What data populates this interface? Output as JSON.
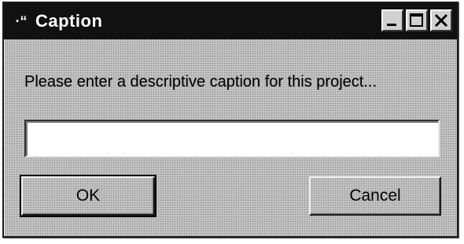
{
  "window": {
    "title": "Caption",
    "icon": "caption-app-icon",
    "title_icon_glyph": "·“",
    "controls": [
      "minimize-icon",
      "maximize-icon",
      "close-icon"
    ]
  },
  "dialog": {
    "prompt": "Please enter a descriptive caption for this project...",
    "input_value": "",
    "ok_label": "OK",
    "cancel_label": "Cancel"
  },
  "colors": {
    "titlebar": "#111111",
    "title_text": "#ffffff",
    "face": "#c4c4c4"
  }
}
